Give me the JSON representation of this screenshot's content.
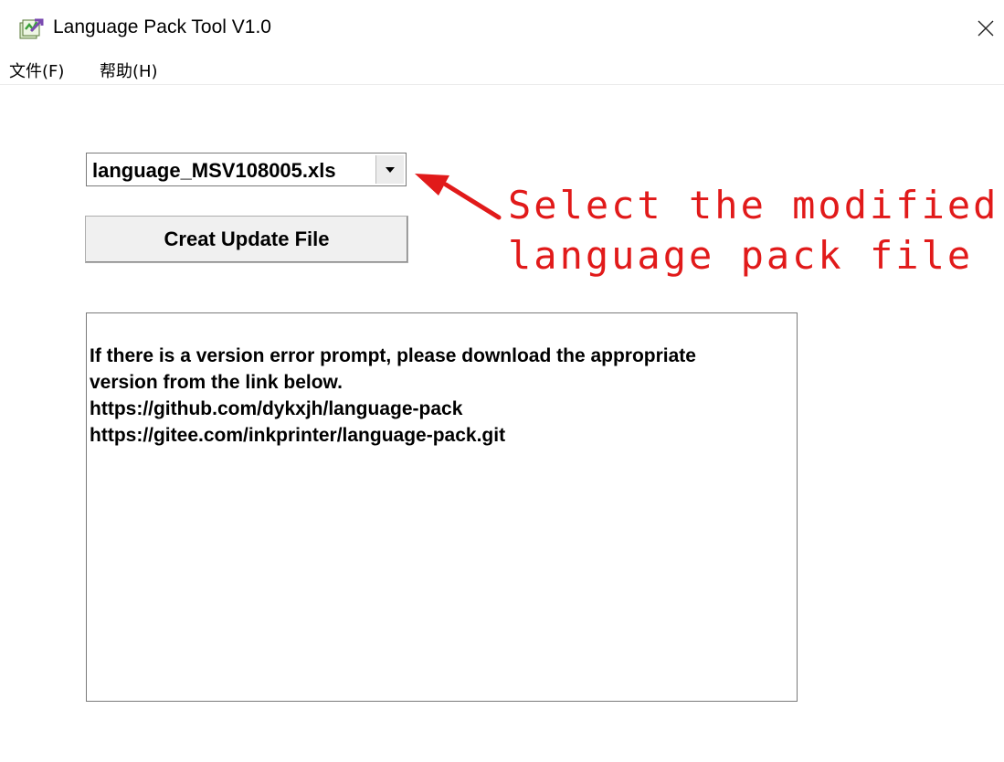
{
  "window": {
    "title": "Language Pack Tool V1.0",
    "icon": "app-icon",
    "close_icon": "close-icon"
  },
  "menu": {
    "items": [
      {
        "label": "文件(F)"
      },
      {
        "label": "帮助(H)"
      }
    ]
  },
  "file_select": {
    "value": "language_MSV108005.xls",
    "arrow_icon": "dropdown-arrow-icon"
  },
  "create_button": {
    "label": "Creat Update File"
  },
  "annotation": {
    "lines": [
      "Select the modified",
      "language pack file"
    ],
    "color": "#e11a1a"
  },
  "info_box": {
    "lines": [
      "If there is a version error prompt, please download the appropriate",
      "version from the link below.",
      "https://github.com/dykxjh/language-pack",
      "https://gitee.com/inkprinter/language-pack.git"
    ]
  }
}
